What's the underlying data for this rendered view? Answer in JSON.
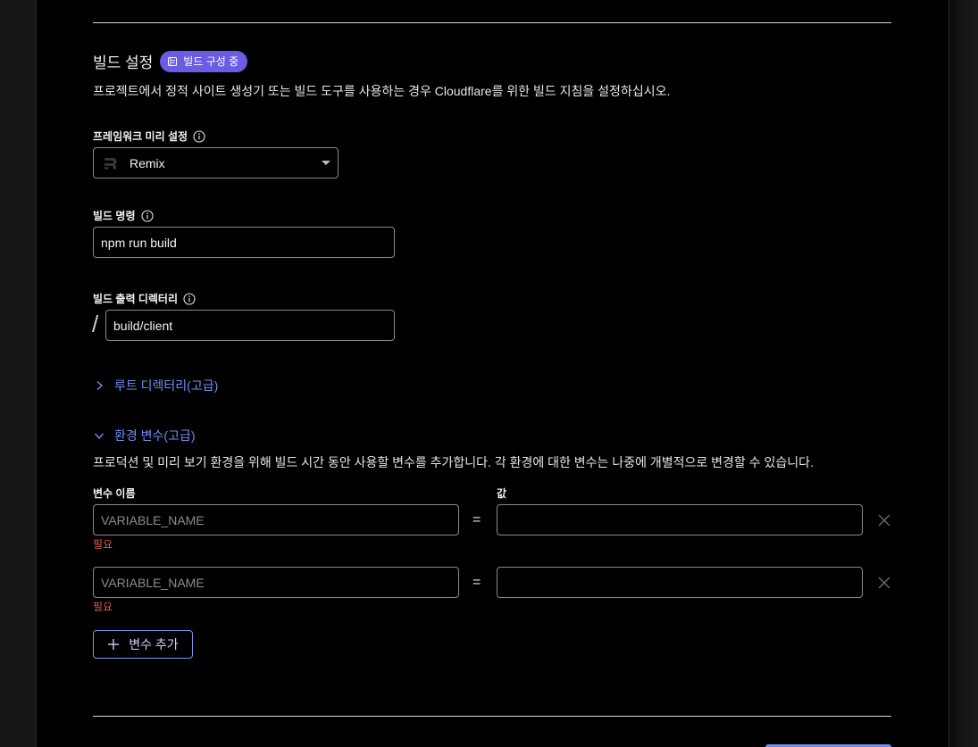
{
  "build_settings": {
    "title": "빌드 설정",
    "badge": "빌드 구성 중",
    "description": "프로젝트에서 정적 사이트 생성기 또는 빌드 도구를 사용하는 경우 Cloudflare를 위한 빌드 지침을 설정하십시오."
  },
  "framework": {
    "label": "프레임워크 미리 설정",
    "value": "Remix"
  },
  "build_command": {
    "label": "빌드 명령",
    "value": "npm run build"
  },
  "output_dir": {
    "label": "빌드 출력 디렉터리",
    "prefix": "/",
    "value": "build/client"
  },
  "root_dir": {
    "label": "루트 디렉터리(고급)"
  },
  "env_vars": {
    "label": "환경 변수(고급)",
    "description": "프로덕션 및 미리 보기 환경을 위해 빌드 시간 동안 사용할 변수를 추가합니다. 각 환경에 대한 변수는 나중에 개별적으로 변경할 수 있습니다.",
    "name_column": "변수 이름",
    "value_column": "값",
    "equals": "=",
    "rows": [
      {
        "name_placeholder": "VARIABLE_NAME",
        "name": "",
        "value": "",
        "error": "필요"
      },
      {
        "name_placeholder": "VARIABLE_NAME",
        "name": "",
        "value": "",
        "error": "필요"
      }
    ],
    "add_button": "변수 추가"
  },
  "colors": {
    "accent": "#6a5ce3",
    "link": "#6e8ef5",
    "error": "#e05a4f"
  }
}
